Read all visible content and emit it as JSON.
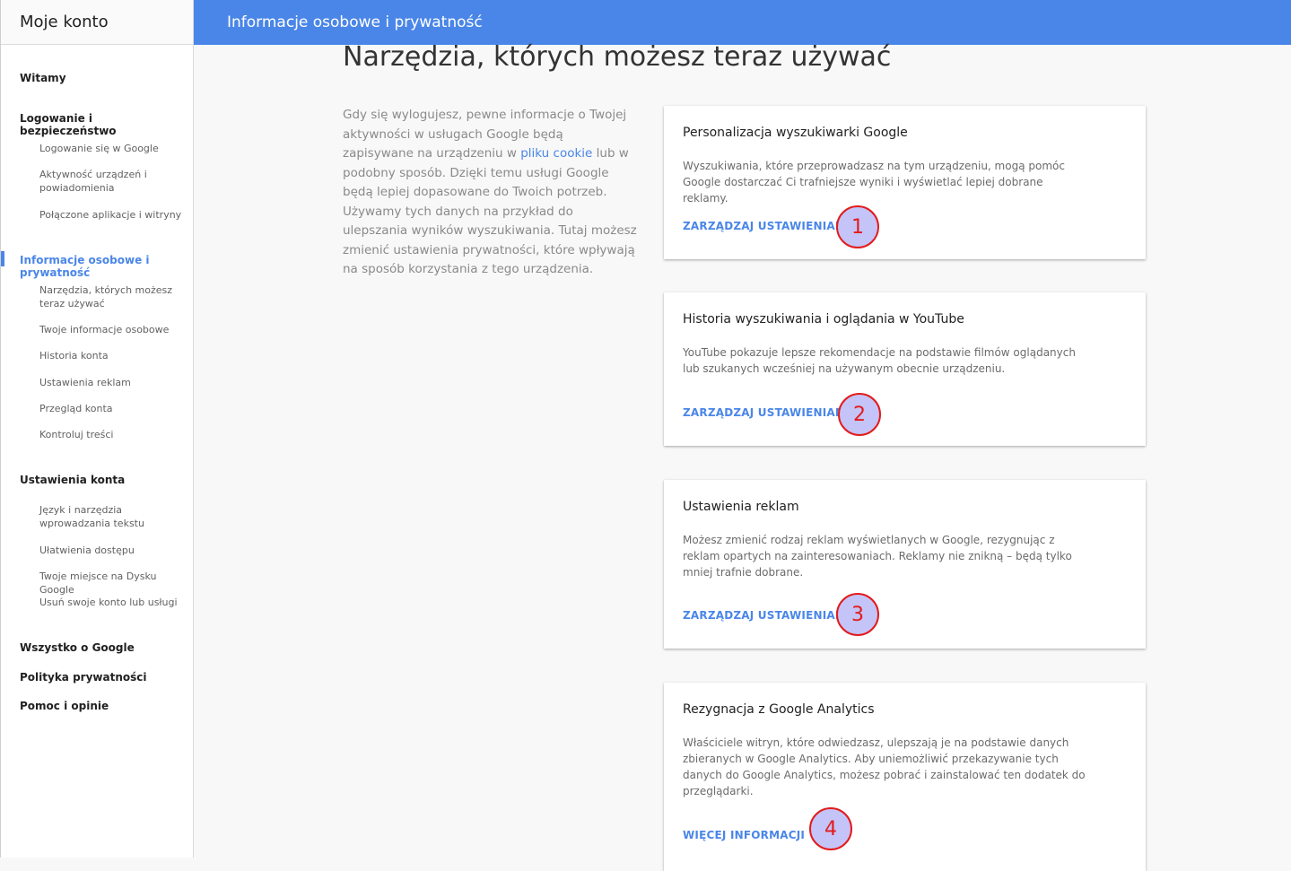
{
  "sidebar": {
    "title": "Moje konto",
    "items": [
      {
        "label": "Witamy"
      },
      {
        "label": "Logowanie i bezpieczeństwo"
      },
      {
        "label": "Logowanie się w Google"
      },
      {
        "label": "Aktywność urządzeń i powiadomienia"
      },
      {
        "label": "Połączone aplikacje i witryny"
      },
      {
        "label": "Informacje osobowe i prywatność"
      },
      {
        "label": "Narzędzia, których możesz teraz używać"
      },
      {
        "label": "Twoje informacje osobowe"
      },
      {
        "label": "Historia konta"
      },
      {
        "label": "Ustawienia reklam"
      },
      {
        "label": "Przegląd konta"
      },
      {
        "label": "Kontroluj treści"
      },
      {
        "label": "Ustawienia konta"
      },
      {
        "label": "Język i narzędzia wprowadzania tekstu"
      },
      {
        "label": "Ułatwienia dostępu"
      },
      {
        "label": "Twoje miejsce na Dysku Google"
      },
      {
        "label": "Usuń swoje konto lub usługi"
      },
      {
        "label": "Wszystko o Google"
      },
      {
        "label": "Polityka prywatności"
      },
      {
        "label": "Pomoc i opinie"
      }
    ]
  },
  "header": {
    "title": "Informacje osobowe i prywatność"
  },
  "main": {
    "title": "Narzędzia, których możesz teraz używać",
    "intro_before": "Gdy się wylogujesz, pewne informacje o Twojej aktywności w usługach Google będą zapisywane na urządzeniu w ",
    "intro_link": "pliku cookie",
    "intro_after": " lub w podobny sposób. Dzięki temu usługi Google będą lepiej dopasowane do Twoich potrzeb. Używamy tych danych na przykład do ulepszania wyników wyszukiwania. Tutaj możesz zmienić ustawienia prywatności, które wpływają na sposób korzystania z tego urządzenia.",
    "cards": [
      {
        "title": "Personalizacja wyszukiwarki Google",
        "desc": "Wyszukiwania, które przeprowadzasz na tym urządzeniu, mogą pomóc Google dostarczać Ci trafniejsze wyniki i wyświetlać lepiej dobrane reklamy.",
        "action": "ZARZĄDZAJ USTAWIENIAMI",
        "marker": "1"
      },
      {
        "title": "Historia wyszukiwania i oglądania w YouTube",
        "desc": "YouTube pokazuje lepsze rekomendacje na podstawie filmów oglądanych lub szukanych wcześniej na używanym obecnie urządzeniu.",
        "action": "ZARZĄDZAJ USTAWIENIAMI",
        "marker": "2"
      },
      {
        "title": "Ustawienia reklam",
        "desc": "Możesz zmienić rodzaj reklam wyświetlanych w Google, rezygnując z reklam opartych na zainteresowaniach. Reklamy nie znikną – będą tylko mniej trafnie dobrane.",
        "action": "ZARZĄDZAJ USTAWIENIAMI",
        "marker": "3"
      },
      {
        "title": "Rezygnacja z Google Analytics",
        "desc": "Właściciele witryn, które odwiedzasz, ulepszają je na podstawie danych zbieranych w Google Analytics. Aby uniemożliwić przekazywanie tych danych do Google Analytics, możesz pobrać i zainstalować ten dodatek do przeglądarki.",
        "action": "WIĘCEJ INFORMACJI",
        "marker": "4"
      }
    ]
  },
  "colors": {
    "accent": "#4a86e8",
    "marker_fill": "#c4c4f8",
    "marker_stroke": "#e31b1b"
  }
}
